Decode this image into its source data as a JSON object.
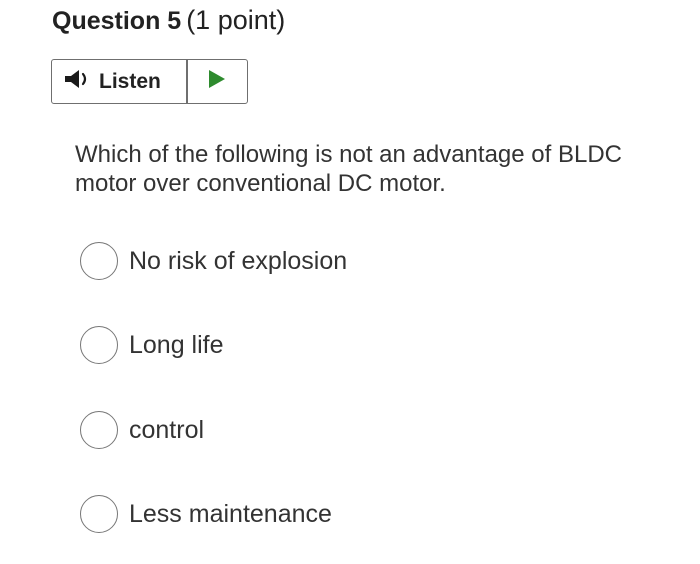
{
  "question": {
    "title": "Question 5",
    "points": "(1 point)",
    "text": "Which of the following is not an advantage of BLDC motor over conventional DC motor."
  },
  "listen": {
    "label": "Listen",
    "speaker_icon": "speaker-icon",
    "play_icon": "play-icon",
    "play_color": "#2e8b2e"
  },
  "options": [
    {
      "label": "No risk of explosion"
    },
    {
      "label": "Long life"
    },
    {
      "label": "control"
    },
    {
      "label": "Less maintenance"
    }
  ]
}
